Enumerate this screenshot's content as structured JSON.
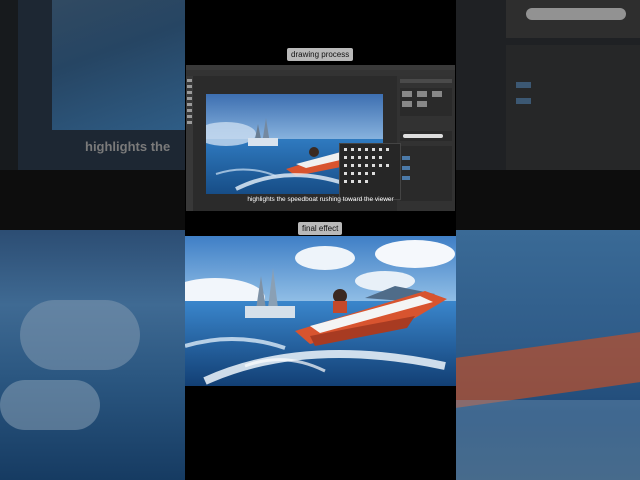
{
  "video": {
    "drawing_label": "drawing process",
    "final_label": "final effect",
    "subtitle": "highlights the speedboat rushing toward the viewer",
    "background_subtitle": "highlights the"
  },
  "colors": {
    "sky": "#6fa4d6",
    "sea": "#1f5d9a",
    "boat_red": "#d8542f",
    "panel": "#323232"
  }
}
